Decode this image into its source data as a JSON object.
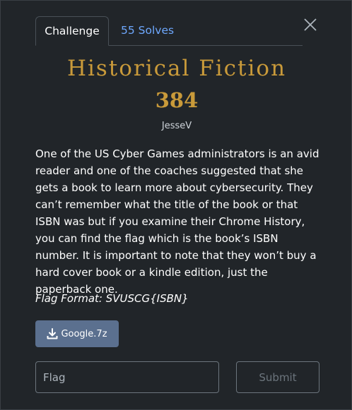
{
  "tabs": {
    "challenge": "Challenge",
    "solves": "55 Solves"
  },
  "challenge": {
    "title": "Historical Fiction",
    "points": "384",
    "author": "JesseV",
    "description": "One of the US Cyber Games administrators is an avid reader and one of the coaches suggested that she gets a book to learn more about cybersecurity. They can’t remember what the title of the book or that ISBN was but if you examine their Chrome History, you can find the flag which is the book’s ISBN number. It is important to note that they won’t buy a hard cover book or a kindle edition, just the paperback one.",
    "flag_format": "Flag Format: SVUSCG{ISBN}"
  },
  "attachment": {
    "filename": "Google.7z",
    "icon": "download-icon"
  },
  "form": {
    "flag_placeholder": "Flag",
    "submit_label": "Submit"
  },
  "colors": {
    "title": "#c99a3a",
    "tab_link": "#6ea8fe",
    "download_button": "#5b708f",
    "background": "#212529"
  }
}
